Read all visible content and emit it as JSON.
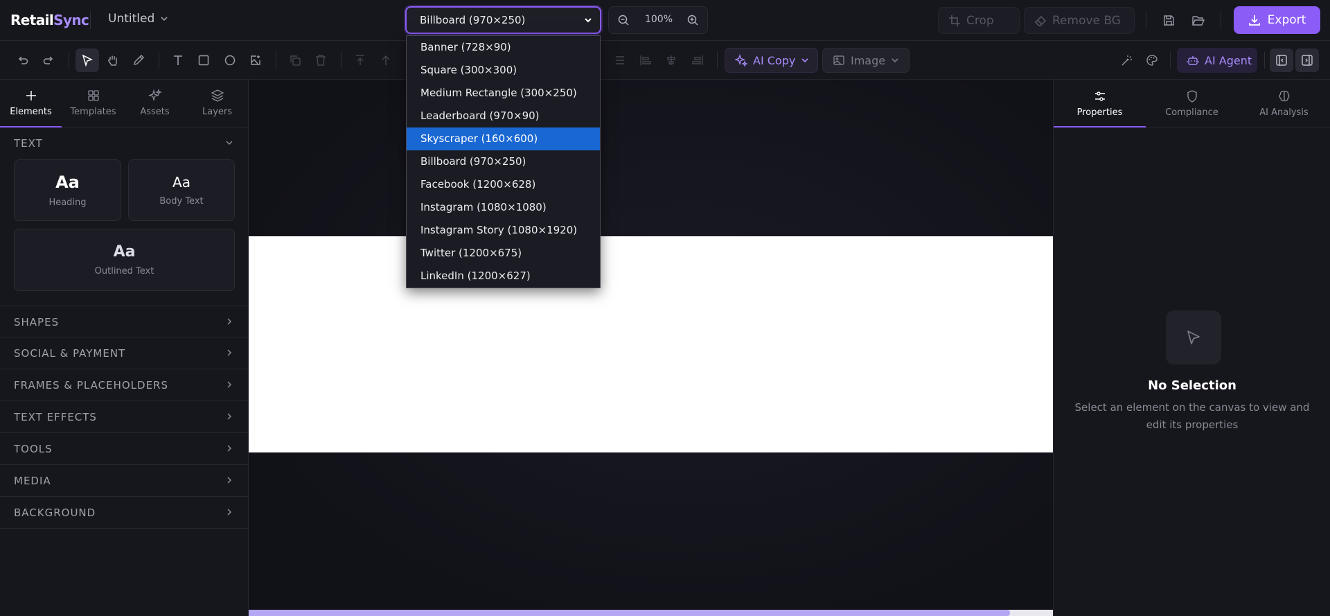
{
  "app": {
    "logo_main": "Retail",
    "logo_accent": "Sync",
    "doc_title": "Untitled"
  },
  "size_select": {
    "value": "Billboard (970×250)",
    "options": [
      "Banner (728×90)",
      "Square (300×300)",
      "Medium Rectangle (300×250)",
      "Leaderboard (970×90)",
      "Skyscraper (160×600)",
      "Billboard (970×250)",
      "Facebook (1200×628)",
      "Instagram (1080×1080)",
      "Instagram Story (1080×1920)",
      "Twitter (1200×675)",
      "LinkedIn (1200×627)"
    ],
    "highlighted": "Skyscraper (160×600)"
  },
  "zoom": {
    "value": "100%"
  },
  "header_actions": {
    "crop": "Crop",
    "remove_bg": "Remove BG",
    "export": "Export"
  },
  "toolbar": {
    "ai_copy": "AI Copy",
    "image": "Image",
    "ai_agent": "AI Agent"
  },
  "left_tabs": [
    "Elements",
    "Templates",
    "Assets",
    "Layers"
  ],
  "sections": {
    "text": "TEXT",
    "shapes": "SHAPES",
    "social_payment": "SOCIAL & PAYMENT",
    "frames": "FRAMES & PLACEHOLDERS",
    "text_effects": "TEXT EFFECTS",
    "tools": "TOOLS",
    "media": "MEDIA",
    "background": "BACKGROUND"
  },
  "text_cards": {
    "heading_glyph": "Aa",
    "heading_label": "Heading",
    "body_glyph": "Aa",
    "body_label": "Body Text",
    "outlined_glyph": "Aa",
    "outlined_label": "Outlined Text"
  },
  "right_tabs": [
    "Properties",
    "Compliance",
    "AI Analysis"
  ],
  "empty_state": {
    "title": "No Selection",
    "description": "Select an element on the canvas to view and edit its properties"
  },
  "colors": {
    "accent": "#8b5cf6",
    "accent_light": "#a78bfa",
    "selection": "#1967d2",
    "background": "#121218"
  }
}
